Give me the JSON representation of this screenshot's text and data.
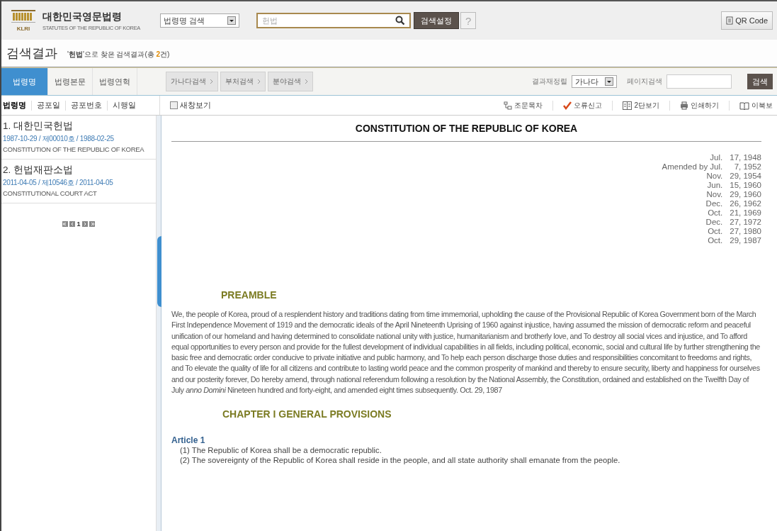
{
  "header": {
    "logo_mark": "KLRI",
    "logo_title": "대한민국영문법령",
    "logo_subtitle": "STATUTES OF THE REPUBLIC OF KOREA",
    "search_type": "법령명 검색",
    "search_value": "헌법",
    "settings_button": "검색설정",
    "help_button": "?",
    "qr_button": "QR Code"
  },
  "results_heading": {
    "title": "검색결과",
    "open_quote": "'",
    "query": "헌법",
    "middle": "'으로 찾은 검색결과(총 ",
    "count": "2",
    "suffix": "건)"
  },
  "tabs": [
    {
      "label": "법령명",
      "selected": true
    },
    {
      "label": "법령본문",
      "selected": false
    },
    {
      "label": "법령연혁",
      "selected": false
    }
  ],
  "filter_buttons": [
    "가나다검색",
    "부처검색",
    "분야검색"
  ],
  "sort_filter": {
    "label": "결과재정렬",
    "value": "가나다"
  },
  "page_search": {
    "label": "페이지검색",
    "button": "검색"
  },
  "sort_links": [
    {
      "label": "법령명",
      "selected": true
    },
    {
      "label": "공포일",
      "selected": false
    },
    {
      "label": "공포번호",
      "selected": false
    },
    {
      "label": "시행일",
      "selected": false
    }
  ],
  "new_window": {
    "label": "새창보기",
    "checked": false
  },
  "toolbar": [
    {
      "kind": "toc",
      "label": "조문목차"
    },
    {
      "kind": "report",
      "label": "오류신고"
    },
    {
      "kind": "columns",
      "label": "2단보기"
    },
    {
      "kind": "print",
      "label": "인쇄하기"
    },
    {
      "kind": "ebook",
      "label": "이북보"
    }
  ],
  "results": [
    {
      "title": "1. 대한민국헌법",
      "meta": "1987-10-29 / 제00010호 / 1988-02-25",
      "english": "CONSTITUTION OF THE REPUBLIC OF KOREA"
    },
    {
      "title": "2. 헌법재판소법",
      "meta": "2011-04-05 / 제10546호 / 2011-04-05",
      "english": "CONSTITUTIONAL COURT ACT"
    }
  ],
  "pagination": {
    "current": "1"
  },
  "document": {
    "title": "CONSTITUTION OF THE REPUBLIC OF KOREA",
    "dates": [
      {
        "month": "Jul.",
        "day_year": "17, 1948"
      },
      {
        "month": "Amended by Jul.",
        "day_year": "7, 1952"
      },
      {
        "month": "Nov.",
        "day_year": "29, 1954"
      },
      {
        "month": "Jun.",
        "day_year": "15, 1960"
      },
      {
        "month": "Nov.",
        "day_year": "29, 1960"
      },
      {
        "month": "Dec.",
        "day_year": "26, 1962"
      },
      {
        "month": "Oct.",
        "day_year": "21, 1969"
      },
      {
        "month": "Dec.",
        "day_year": "27, 1972"
      },
      {
        "month": "Oct.",
        "day_year": "27, 1980"
      },
      {
        "month": "Oct.",
        "day_year": "29, 1987"
      }
    ],
    "preamble_heading": "PREAMBLE",
    "preamble": "We, the people of Korea, proud of a resplendent history and traditions dating from time immemorial, upholding the cause of the Provisional Republic of Korea Government born of the March First Independence Movement of 1919 and the democratic ideals of the April Nineteenth Uprising of 1960 against injustice, having assumed the mission of democratic reform and peaceful unification of our homeland and having determined to consolidate national unity with justice, humanitarianism and brotherly love, and To destroy all social vices and injustice, and To afford equal opportunities to every person and provide for the fullest development of individual capabilities in all fields, including political, economic, social and cultural life by further strengthening the basic free and democratic order conducive to private initiative and public harmony, and To help each person discharge those duties and responsibilities concomitant to freedoms and rights, and To elevate the quality of life for all citizens and contribute to lasting world peace and the common prosperity of mankind and thereby to ensure security, liberty and happiness for ourselves and our posterity forever, Do hereby amend, through national referendum following a resolution by the National Assembly, the Constitution, ordained and established on the Twelfth Day of July *anno Domini* Nineteen hundred and forty-eight, and amended eight times subsequently. Oct. 29, 1987",
    "chapter_heading": "CHAPTER I GENERAL PROVISIONS",
    "article_heading": "Article 1",
    "clauses": [
      "(1) The Republic of Korea shall be a democratic republic.",
      "(2) The sovereignty of the Republic of Korea shall reside in the people, and all state authority shall emanate from the people."
    ]
  }
}
